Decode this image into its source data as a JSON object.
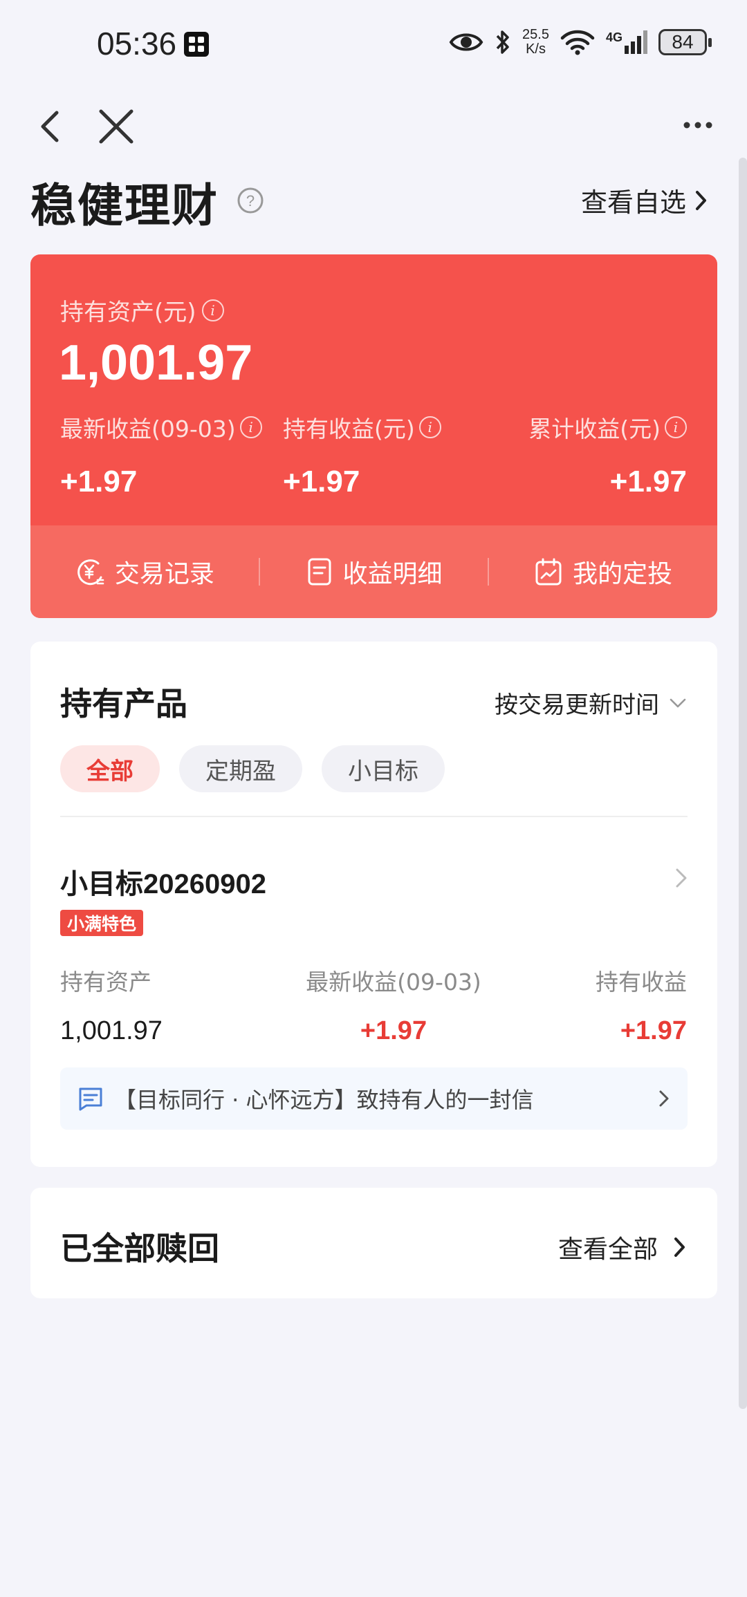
{
  "status_bar": {
    "time": "05:36",
    "speed_value": "25.5",
    "speed_unit": "K/s",
    "network": "4G",
    "battery": "84"
  },
  "header": {
    "title": "稳健理财",
    "view_favorites": "查看自选"
  },
  "asset_card": {
    "holding_assets_label": "持有资产(元)",
    "holding_assets_value": "1,001.97",
    "stats": [
      {
        "label": "最新收益(09-03)",
        "value": "+1.97"
      },
      {
        "label": "持有收益(元)",
        "value": "+1.97"
      },
      {
        "label": "累计收益(元)",
        "value": "+1.97"
      }
    ],
    "actions": [
      {
        "label": "交易记录",
        "icon": "yuan-clock-icon"
      },
      {
        "label": "收益明细",
        "icon": "document-icon"
      },
      {
        "label": "我的定投",
        "icon": "calendar-icon"
      }
    ]
  },
  "holdings": {
    "title": "持有产品",
    "sort_label": "按交易更新时间",
    "filters": [
      {
        "label": "全部",
        "active": true
      },
      {
        "label": "定期盈",
        "active": false
      },
      {
        "label": "小目标",
        "active": false
      }
    ],
    "product": {
      "name": "小目标20260902",
      "tag": "小满特色",
      "columns": [
        {
          "label": "持有资产",
          "value": "1,001.97"
        },
        {
          "label": "最新收益(09-03)",
          "value": "+1.97"
        },
        {
          "label": "持有收益",
          "value": "+1.97"
        }
      ],
      "letter": "【目标同行 · 心怀远方】致持有人的一封信"
    }
  },
  "redeemed": {
    "title": "已全部赎回",
    "view_all": "查看全部"
  },
  "colors": {
    "card_red": "#f5524c",
    "action_bar": "#f66a61",
    "profit_red": "#e83c36",
    "page_bg": "#f4f4fa"
  }
}
